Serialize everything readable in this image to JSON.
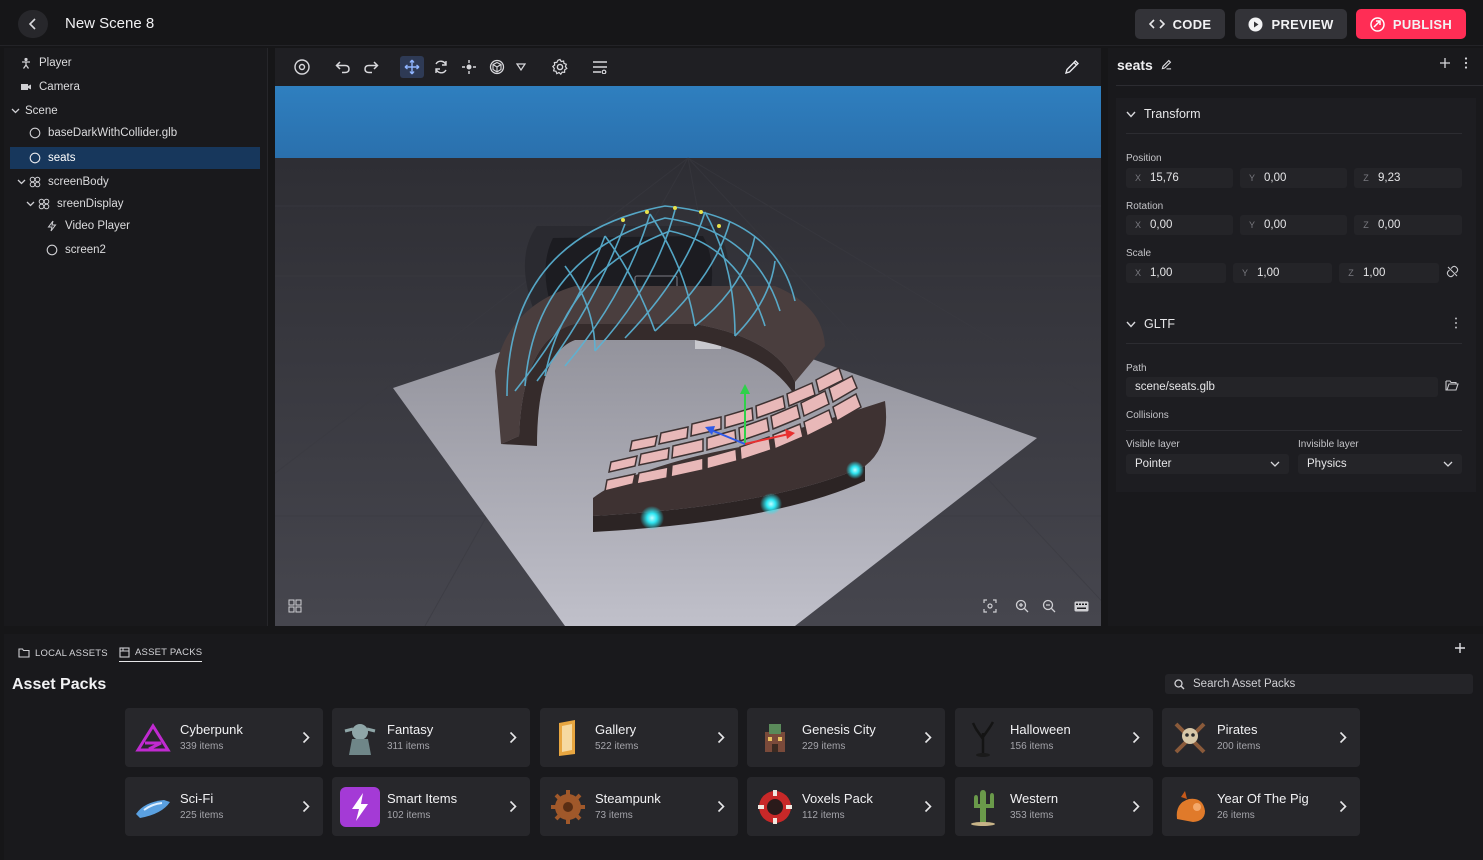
{
  "header": {
    "title": "New Scene 8",
    "code_label": "CODE",
    "preview_label": "PREVIEW",
    "publish_label": "PUBLISH"
  },
  "hierarchy": {
    "items": [
      {
        "label": "Player"
      },
      {
        "label": "Camera"
      },
      {
        "label": "Scene"
      },
      {
        "label": "baseDarkWithCollider.glb"
      },
      {
        "label": "seats"
      },
      {
        "label": "screenBody"
      },
      {
        "label": "sreenDisplay"
      },
      {
        "label": "Video Player"
      },
      {
        "label": "screen2"
      }
    ]
  },
  "inspector": {
    "entity_name": "seats",
    "transform": {
      "title": "Transform",
      "position_label": "Position",
      "rotation_label": "Rotation",
      "scale_label": "Scale",
      "axis_x": "X",
      "axis_y": "Y",
      "axis_z": "Z",
      "position": {
        "x": "15,76",
        "y": "0,00",
        "z": "9,23"
      },
      "rotation": {
        "x": "0,00",
        "y": "0,00",
        "z": "0,00"
      },
      "scale": {
        "x": "1,00",
        "y": "1,00",
        "z": "1,00"
      }
    },
    "gltf": {
      "title": "GLTF",
      "path_label": "Path",
      "path_value": "scene/seats.glb",
      "collisions_label": "Collisions",
      "visible_layer_label": "Visible layer",
      "visible_layer_value": "Pointer",
      "invisible_layer_label": "Invisible layer",
      "invisible_layer_value": "Physics"
    }
  },
  "assets": {
    "tab_local": "LOCAL ASSETS",
    "tab_packs": "ASSET PACKS",
    "title": "Asset Packs",
    "search_placeholder": "Search Asset Packs",
    "packs": [
      {
        "name": "Cyberpunk",
        "count": "339 items",
        "color": "#c02ad0"
      },
      {
        "name": "Fantasy",
        "count": "311 items",
        "color": "#8fa6a8"
      },
      {
        "name": "Gallery",
        "count": "522 items",
        "color": "#e8a640"
      },
      {
        "name": "Genesis City",
        "count": "229 items",
        "color": "#7a4a3a"
      },
      {
        "name": "Halloween",
        "count": "156 items",
        "color": "#2a2a2a"
      },
      {
        "name": "Pirates",
        "count": "200 items",
        "color": "#d8c8a8"
      },
      {
        "name": "Sci-Fi",
        "count": "225 items",
        "color": "#5aa0e0"
      },
      {
        "name": "Smart Items",
        "count": "102 items",
        "color": "#a43ad6"
      },
      {
        "name": "Steampunk",
        "count": "73 items",
        "color": "#a0582a"
      },
      {
        "name": "Voxels Pack",
        "count": "112 items",
        "color": "#c82828"
      },
      {
        "name": "Western",
        "count": "353 items",
        "color": "#6a9a4a"
      },
      {
        "name": "Year Of The Pig",
        "count": "26 items",
        "color": "#e07a2a"
      }
    ]
  }
}
